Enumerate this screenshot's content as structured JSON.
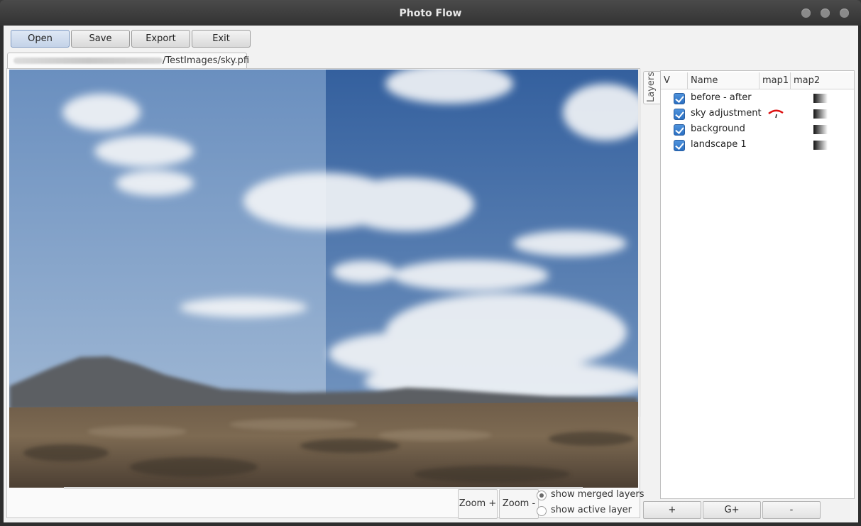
{
  "window": {
    "title": "Photo Flow"
  },
  "toolbar": {
    "open_label": "Open",
    "save_label": "Save",
    "export_label": "Export",
    "exit_label": "Exit"
  },
  "file_tab": {
    "path": "/TestImages/sky.pfi"
  },
  "view_controls": {
    "zoom_in_label": "Zoom +",
    "zoom_out_label": "Zoom -",
    "show_merged_label": "show merged layers",
    "show_active_label": "show active layer",
    "selected_mode": "show merged layers"
  },
  "layers_panel": {
    "tab_label": "Layers",
    "columns": [
      "V",
      "Name",
      "map1",
      "map2"
    ],
    "layers": [
      {
        "name": "before - after",
        "visible": true,
        "map1": "",
        "map2": "gradient-mask-icon"
      },
      {
        "name": "sky adjustment",
        "visible": true,
        "map1": "curves-icon",
        "map2": "gradient-mask-icon"
      },
      {
        "name": "background",
        "visible": true,
        "map1": "",
        "map2": "gradient-mask-icon"
      },
      {
        "name": "landscape 1",
        "visible": true,
        "map1": "",
        "map2": "gradient-mask-icon"
      }
    ],
    "add_label": "+",
    "add_group_label": "G+",
    "remove_label": "-"
  },
  "colors": {
    "accent": "#2a6fc2",
    "titlebar": "#3c3c3c"
  }
}
